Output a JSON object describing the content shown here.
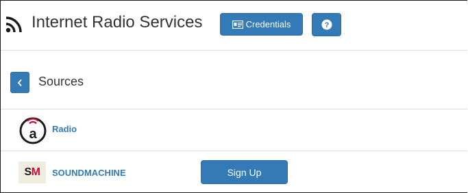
{
  "header": {
    "title": "Internet Radio Services",
    "rss_icon": "rss-feed-icon",
    "credentials_label": "Credentials",
    "credentials_icon": "id-card-icon",
    "help_icon": "question-circle-icon"
  },
  "sources": {
    "back_icon": "chevron-left-icon",
    "title": "Sources"
  },
  "services": [
    {
      "name": "Radio",
      "logo": "radio-logo-a",
      "action": ""
    },
    {
      "name": "SOUNDMACHINE",
      "logo_text_s": "S",
      "logo_text_m": "M",
      "action": "Sign Up"
    }
  ],
  "colors": {
    "primary": "#337ab7",
    "link": "#337ab7",
    "sm_logo_bg": "#f1ece0",
    "sm_logo_red": "#c8102e"
  }
}
